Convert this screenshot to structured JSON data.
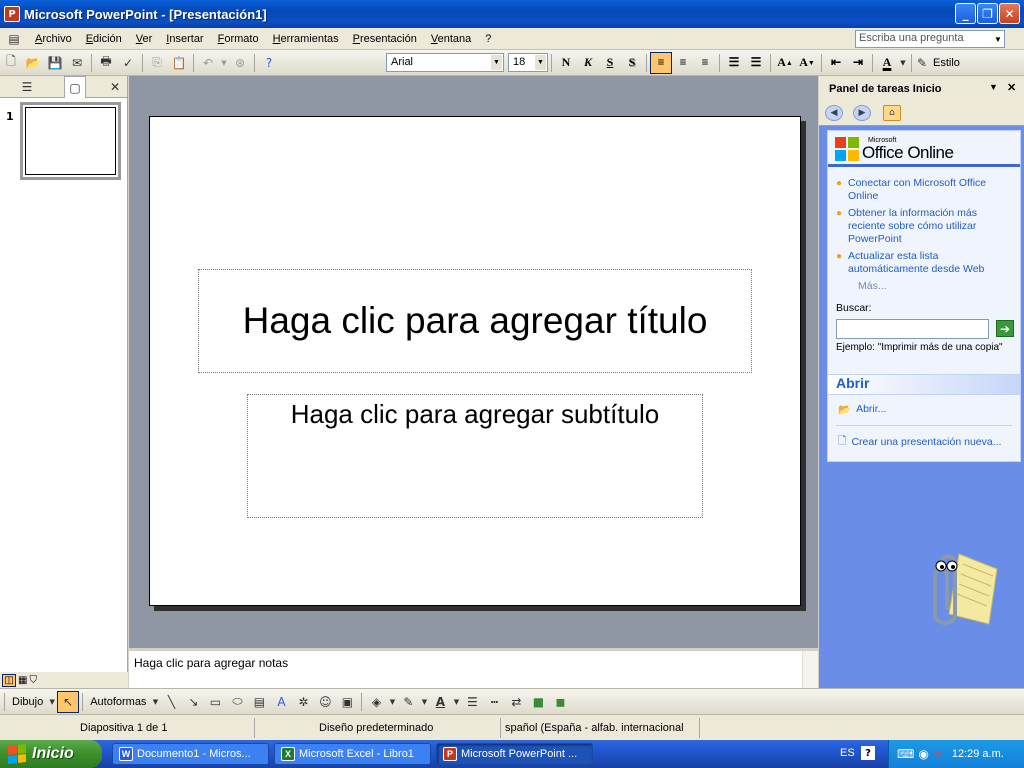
{
  "window": {
    "title": "Microsoft PowerPoint - [Presentación1]",
    "app_icon_letter": "P",
    "minimize": "_",
    "restore": "❐",
    "close": "✕"
  },
  "menu": {
    "items": [
      "Archivo",
      "Edición",
      "Ver",
      "Insertar",
      "Formato",
      "Herramientas",
      "Presentación",
      "Ventana",
      "?"
    ],
    "ask_placeholder": "Escriba una pregunta"
  },
  "toolbar": {
    "font": "Arial",
    "size": "18",
    "bold": "N",
    "italic": "K",
    "underline": "S",
    "shadow": "S",
    "style_label": "Estilo"
  },
  "slides_panel": {
    "slide_number": "1"
  },
  "slide": {
    "title_placeholder": "Haga clic para agregar título",
    "subtitle_placeholder": "Haga clic para agregar subtítulo"
  },
  "notes": {
    "placeholder": "Haga clic para agregar notas"
  },
  "task_pane": {
    "title": "Panel de tareas Inicio",
    "brand_small": "Microsoft",
    "brand": "Office Online",
    "links": [
      "Conectar con Microsoft Office Online",
      "Obtener la información más reciente sobre cómo utilizar PowerPoint",
      "Actualizar esta lista automáticamente desde Web"
    ],
    "more": "Más...",
    "search_label": "Buscar:",
    "example": "Ejemplo:  \"Imprimir más de una copia\"",
    "open_header": "Abrir",
    "open_link": "Abrir...",
    "new_link": "Crear una presentación nueva..."
  },
  "drawing_toolbar": {
    "draw": "Dibujo",
    "autoshapes": "Autoformas"
  },
  "status": {
    "slide_info": "Diapositiva 1 de 1",
    "design": "Diseño predeterminado",
    "language": "spañol (España - alfab. internacional"
  },
  "taskbar": {
    "start": "Inicio",
    "buttons": [
      {
        "label": "Documento1 - Micros...",
        "icon": "W",
        "color": "#2a5bd8"
      },
      {
        "label": "Microsoft Excel - Libro1",
        "icon": "X",
        "color": "#1e7b2c"
      },
      {
        "label": "Microsoft PowerPoint ...",
        "icon": "P",
        "color": "#c23a1e"
      }
    ],
    "lang": "ES",
    "clock": "12:29 a.m."
  }
}
